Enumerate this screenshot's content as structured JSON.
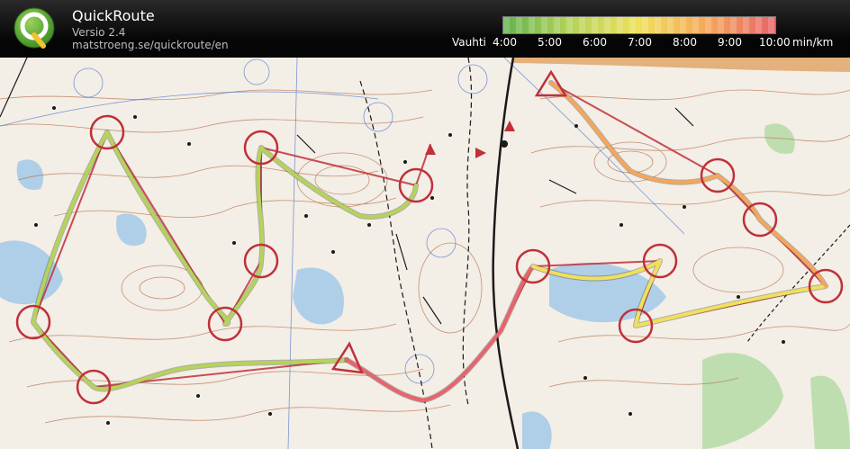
{
  "app": {
    "title": "QuickRoute",
    "version": "Versio 2.4",
    "url": "matstroeng.se/quickroute/en"
  },
  "legend": {
    "label": "Vauhti",
    "ticks": [
      "4:00",
      "5:00",
      "6:00",
      "7:00",
      "8:00",
      "9:00",
      "10:00"
    ],
    "unit": "min/km",
    "colors": [
      "#62b34d",
      "#b5d35a",
      "#f0e05a",
      "#f5a65a",
      "#e8646a"
    ]
  },
  "map": {
    "colors": {
      "paper": "#f3eee6",
      "contour": "#b8714a",
      "rock": "#1a1a1a",
      "water": "#9ec6e8",
      "green": "#b8dca8",
      "course": "#c0303a",
      "road": "#e0a060"
    }
  }
}
